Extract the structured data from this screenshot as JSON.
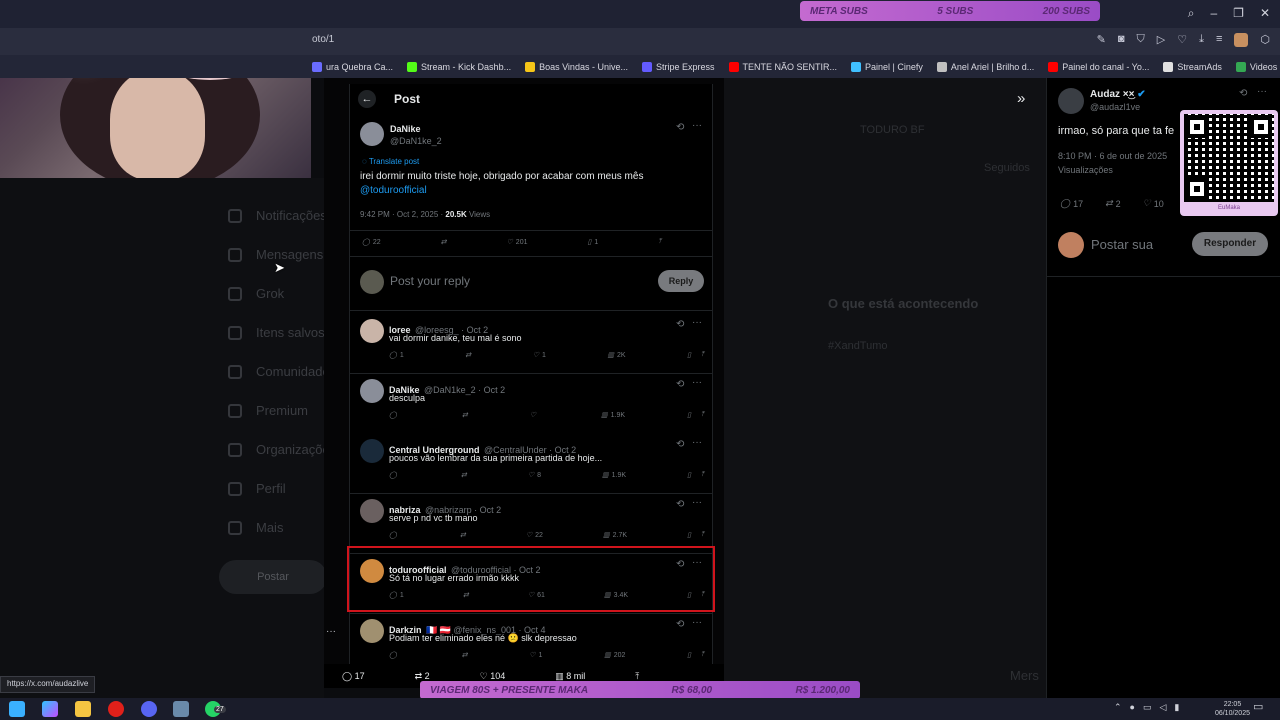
{
  "browser": {
    "url_partial": "oto/1",
    "bookmarks": [
      {
        "label": "ura Quebra Ca...",
        "color": "#6a6cff"
      },
      {
        "label": "Stream - Kick Dashb...",
        "color": "#53fc18"
      },
      {
        "label": "Boas Vindas - Unive...",
        "color": "#f5c518"
      },
      {
        "label": "Stripe Express",
        "color": "#635bff"
      },
      {
        "label": "TENTE NÃO SENTIR...",
        "color": "#ff0000"
      },
      {
        "label": "Painel | Cinefy",
        "color": "#40c0ff"
      },
      {
        "label": "Anel Ariel | Brilho d...",
        "color": "#c0c0c0"
      },
      {
        "label": "Painel do canal - Yo...",
        "color": "#ff0000"
      },
      {
        "label": "StreamAds",
        "color": "#e0e0e0"
      },
      {
        "label": "Videos Maka - Goo...",
        "color": "#34a853"
      }
    ]
  },
  "overlay": {
    "subs_goal": {
      "left": "META SUBS",
      "current": "5 SUBS",
      "target": "200 SUBS"
    },
    "donation_goal": {
      "left": "VIAGEM 80S + PRESENTE MAKA",
      "current": "R$ 68,00",
      "target": "R$ 1.200,00"
    },
    "qr_caption": "EuMaka"
  },
  "background_nav": [
    "Notificações",
    "Mensagens",
    "Grok",
    "Itens salvos",
    "Comunidades",
    "Premium",
    "Organizações",
    "Perfil",
    "Mais"
  ],
  "background_post_button": "Postar",
  "background_text": [
    "TODURO BF",
    "O que está acontecendo",
    "#XandTumo",
    "Seguidos",
    "Mers"
  ],
  "post": {
    "header_title": "Post",
    "author_name": "DaNike",
    "author_handle": "@DaN1ke_2",
    "translate": "Translate post",
    "text": "irei dormir muito triste hoje, obrigado por acabar com meus mês",
    "mention": "@toduroofficial",
    "time": "9:42 PM · Oct 2, 2025 · ",
    "views_count": "20.5K",
    "views_label": " Views",
    "stats": {
      "replies": "22",
      "likes": "201",
      "bookmarks": "1"
    },
    "reply_placeholder": "Post your reply",
    "reply_button": "Reply"
  },
  "replies": [
    {
      "name": "loree",
      "handle": "@loreesg_ · Oct 2",
      "text": "vai dormir danike, teu mal é sono",
      "replies": "1",
      "likes": "1",
      "views": "2K",
      "color": "#c9b4a8"
    },
    {
      "name": "DaNike",
      "handle": "@DaN1ke_2 · Oct 2",
      "text": "desculpa",
      "replies": "",
      "likes": "",
      "views": "1.9K",
      "color": "#8a8e99"
    },
    {
      "name": "Central Underground",
      "handle": "@CentralUnder · Oct 2",
      "text": "poucos vão lembrar da sua primeira partida de hoje...",
      "replies": "",
      "likes": "8",
      "views": "1.9K",
      "color": "#1a2a3a"
    },
    {
      "name": "nabriza",
      "handle": "@nabrizarp · Oct 2",
      "text": "serve p nd vc tb mano",
      "replies": "",
      "likes": "22",
      "views": "2.7K",
      "color": "#6a6060"
    },
    {
      "name": "toduroofficial",
      "handle": "@toduroofficial · Oct 2",
      "text": "Só tá no lugar errado irmão kkkk",
      "replies": "1",
      "likes": "61",
      "views": "3.4K",
      "color": "#d08a40"
    },
    {
      "name": "Darkzin",
      "handle": "🇫🇷 🇦🇹 @fenix_ns_001 · Oct 4",
      "text": "Podiam ter eliminado eles né 😕 slk depressao",
      "replies": "",
      "likes": "1",
      "views": "202",
      "color": "#a09070"
    }
  ],
  "right_panel": {
    "author_name": "Audaz ×͜×",
    "author_handle": "@audazl1ve",
    "text": "irmao, só para que ta fe",
    "time": "8:10 PM · 6 de out de 2025",
    "views_label": "Visualizações",
    "replies": "17",
    "reposts": "2",
    "likes": "10",
    "reply_placeholder": "Postar sua",
    "reply_button": "Responder"
  },
  "bottom_stats": {
    "replies": "17",
    "reposts": "2",
    "likes": "104",
    "views": "8 mil"
  },
  "status_url": "https://x.com/audazlive",
  "taskbar": {
    "time": "22:05",
    "date": "06/10/2025",
    "whatsapp_badge": "27"
  },
  "colors": {
    "accent_blue": "#1d9bf0",
    "goal_purple": "#b45cd0",
    "highlight_red": "#d0141c"
  }
}
